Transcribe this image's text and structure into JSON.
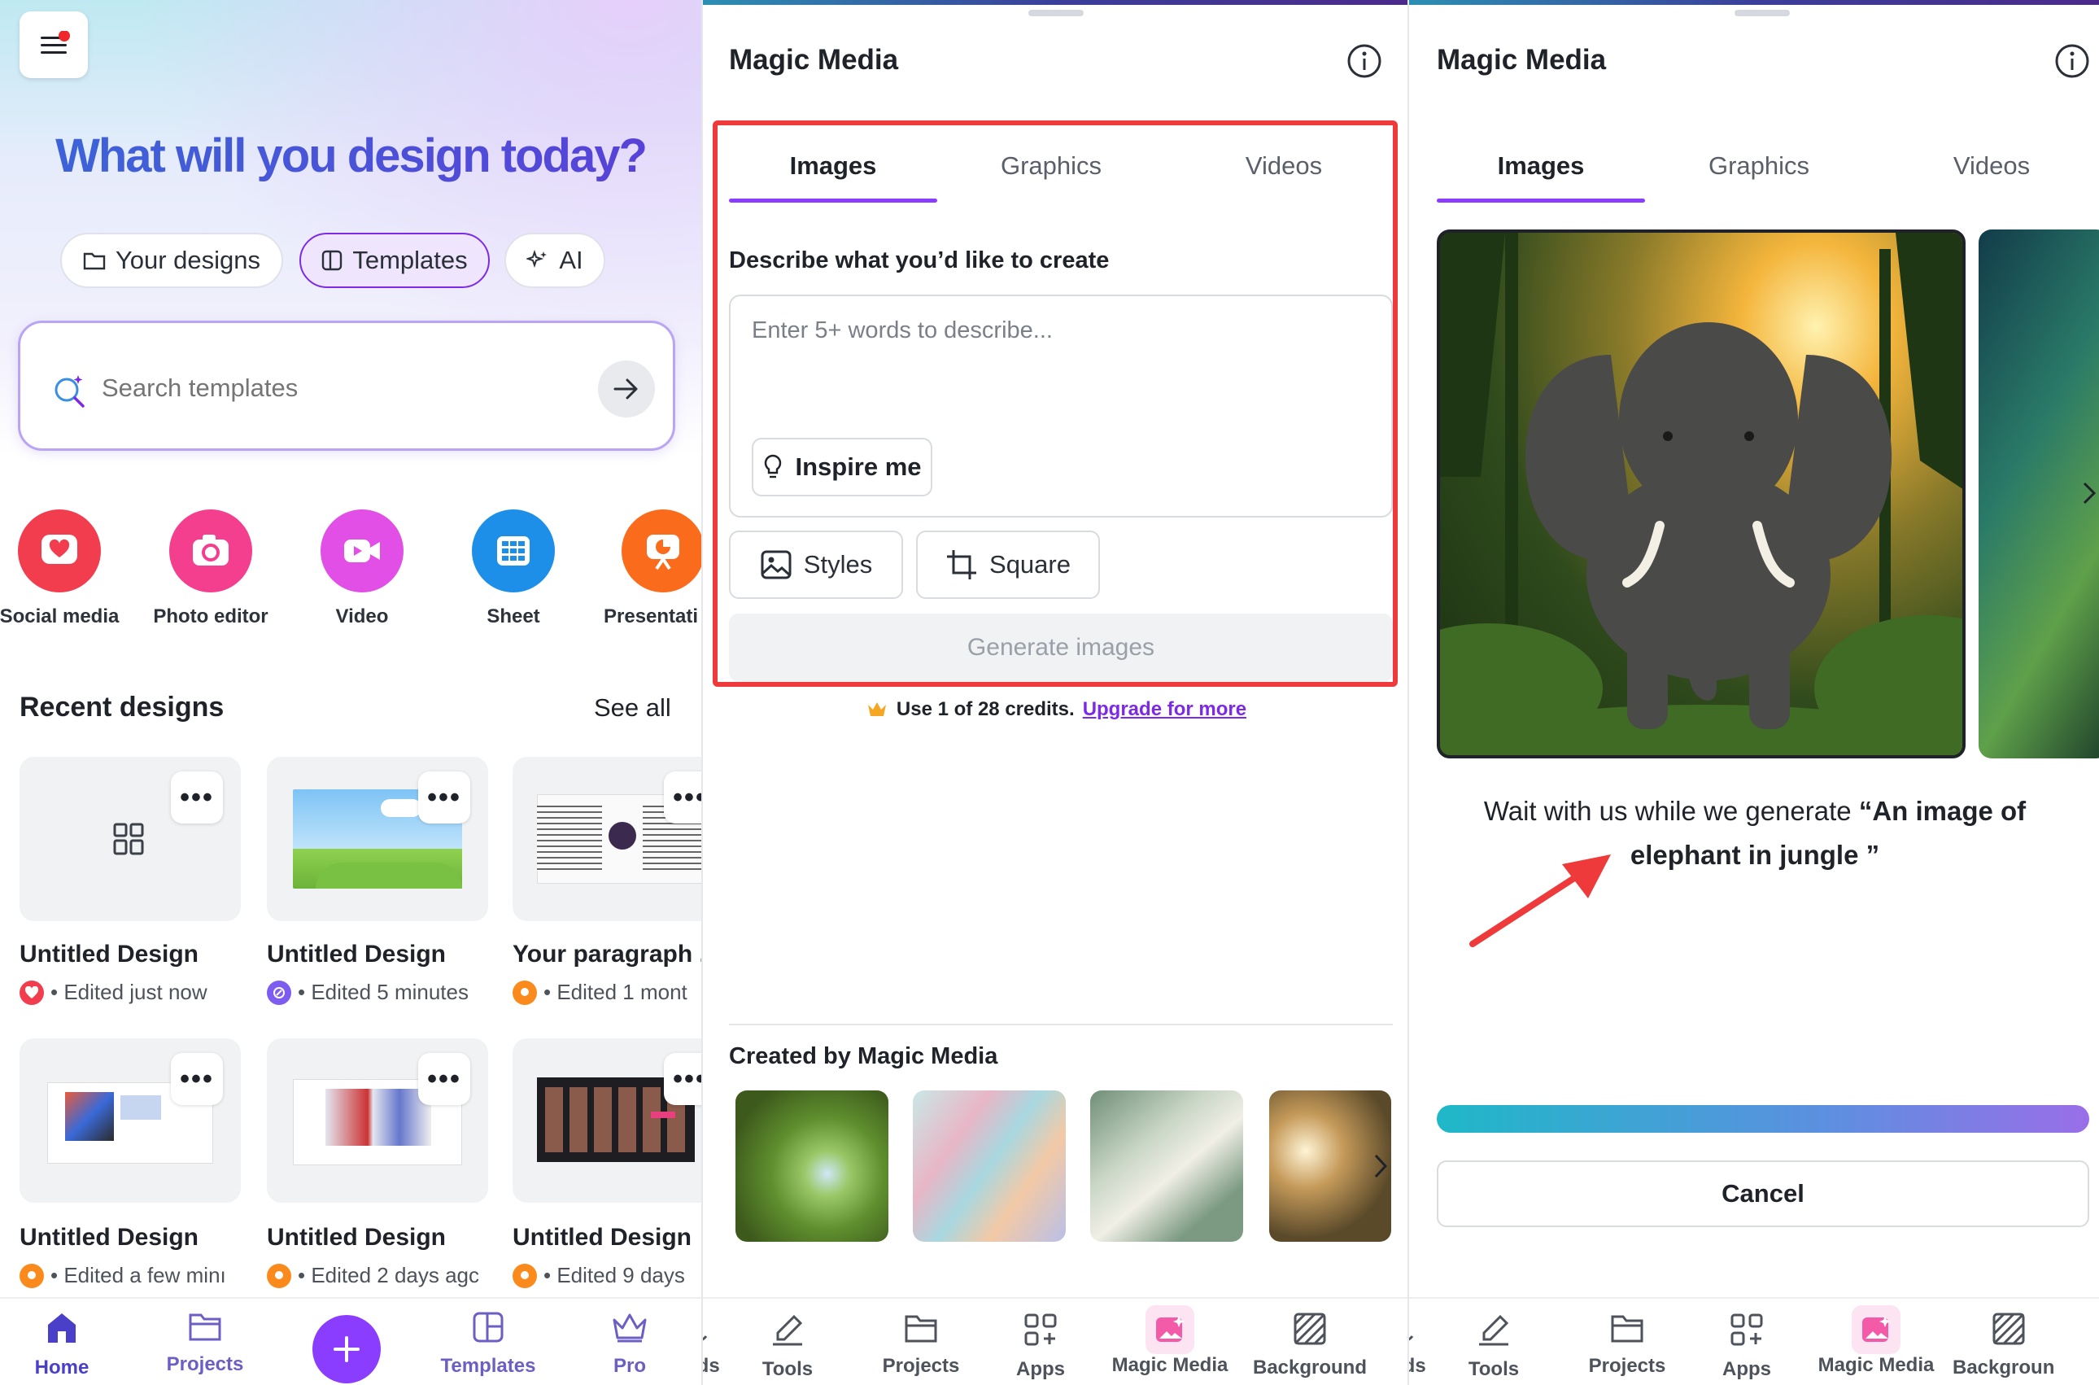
{
  "home": {
    "hero_title": "What will you design today?",
    "chips": [
      {
        "label": "Your designs",
        "icon": "folder-icon"
      },
      {
        "label": "Templates",
        "icon": "template-icon",
        "selected": true
      },
      {
        "label": "AI",
        "icon": "sparkle-icon"
      }
    ],
    "search_placeholder": "Search templates",
    "categories": [
      {
        "label": "Social media",
        "color": "#f23d4e",
        "icon": "heart-icon"
      },
      {
        "label": "Photo editor",
        "color": "#f33f8d",
        "icon": "camera-icon"
      },
      {
        "label": "Video",
        "color": "#e24fe6",
        "icon": "video-icon"
      },
      {
        "label": "Sheet",
        "color": "#1d8fe8",
        "icon": "grid-icon"
      },
      {
        "label": "Presentati",
        "color": "#fb6b1c",
        "icon": "presentation-icon"
      }
    ],
    "recent_title": "Recent designs",
    "see_all": "See all",
    "designs": [
      {
        "title": "Untitled Design",
        "meta": "• Edited just now",
        "badge": "#f23d4e"
      },
      {
        "title": "Untitled Design",
        "meta": "• Edited 5 minutes",
        "badge": "#7d5cf0"
      },
      {
        "title": "Your paragraph .",
        "meta": "• Edited 1 mont",
        "badge": "#fb8a1c"
      },
      {
        "title": "Untitled Design",
        "meta": "• Edited a few minı",
        "badge": "#fb8a1c"
      },
      {
        "title": "Untitled Design",
        "meta": "• Edited 2 days agc",
        "badge": "#fb8a1c"
      },
      {
        "title": "Untitled Design",
        "meta": "• Edited 9 days",
        "badge": "#fb8a1c"
      }
    ],
    "nav": [
      {
        "label": "Home",
        "icon": "home-icon"
      },
      {
        "label": "Projects",
        "icon": "folder-icon"
      },
      {
        "label": "",
        "icon": "plus-icon"
      },
      {
        "label": "Templates",
        "icon": "template-icon"
      },
      {
        "label": "Pro",
        "icon": "crown-icon"
      }
    ]
  },
  "magic_left": {
    "title": "Magic Media",
    "tabs": [
      "Images",
      "Graphics",
      "Videos"
    ],
    "describe_label": "Describe what you’d like to create",
    "prompt_placeholder": "Enter 5+ words to describe...",
    "inspire": "Inspire me",
    "styles": "Styles",
    "aspect": "Square",
    "generate": "Generate images",
    "credits_text": "Use 1 of 28 credits.",
    "upgrade_link": "Upgrade for more",
    "created_title": "Created by Magic Media"
  },
  "magic_right": {
    "title": "Magic Media",
    "tabs": [
      "Images",
      "Graphics",
      "Videos"
    ],
    "wait_text": "Wait with us while we generate",
    "wait_prompt": "“An image of elephant in jungle ”",
    "cancel": "Cancel"
  },
  "toolbar": {
    "partial_left": "ads",
    "items": [
      {
        "label": "Tools",
        "icon": "pen-icon"
      },
      {
        "label": "Projects",
        "icon": "folder-icon"
      },
      {
        "label": "Apps",
        "icon": "apps-icon"
      },
      {
        "label": "Magic Media",
        "icon": "magic-media-icon"
      },
      {
        "label": "Background",
        "icon": "background-icon"
      }
    ],
    "right_last_label": "Backgroun"
  },
  "colors": {
    "accent": "#8b3dff",
    "annotation": "#ee3a3a",
    "hero": "#3b52d6"
  }
}
